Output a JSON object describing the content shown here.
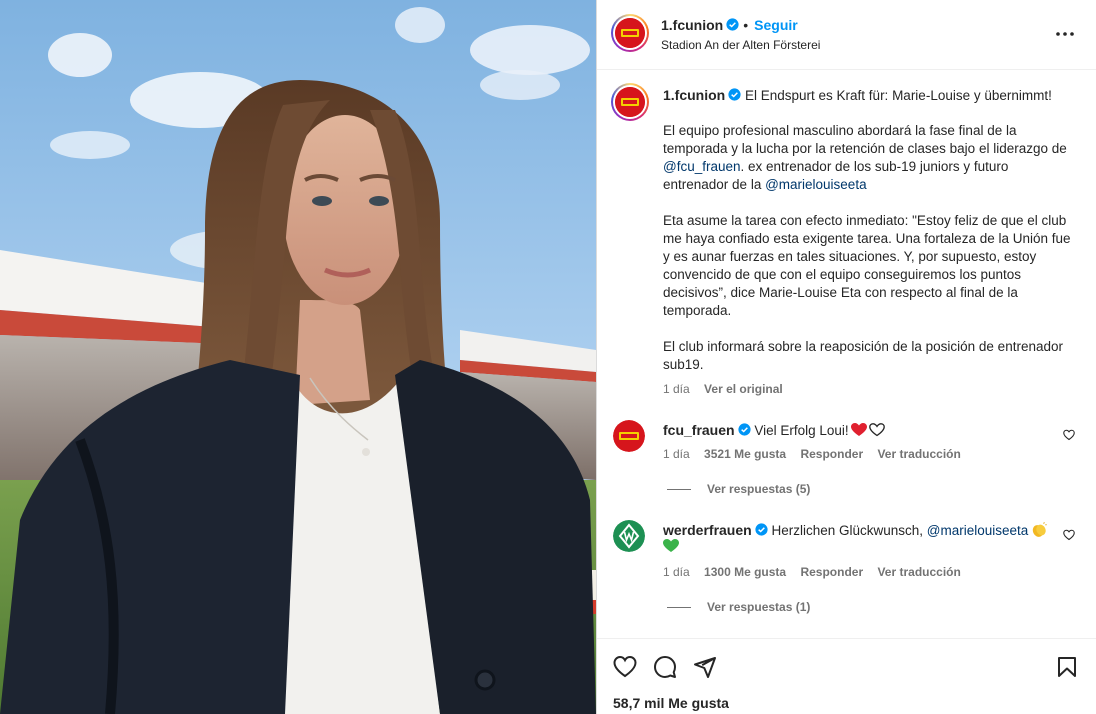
{
  "post": {
    "account": {
      "username": "1.fcunion",
      "follow_label": "Seguir",
      "separator": "•",
      "location": "Stadion An der Alten Försterei",
      "verified": true,
      "avatar_color": "#d6151c"
    },
    "caption": {
      "username": "1.fcunion",
      "headline": "El Endspurt es Kraft für: Marie-Louise y übernimmt!",
      "p1_part1": "El equipo profesional masculino abordará la fase final de la temporada y la lucha por la retención de clases bajo el liderazgo de ",
      "p1_mention1": "@fcu_frauen",
      "p1_part2": ". ex entrenador de los sub-19 juniors y futuro entrenador de la ",
      "p1_mention2": "@marielouiseeta",
      "p2": "Eta asume la tarea con efecto inmediato: \"Estoy feliz de que el club me haya confiado esta exigente tarea. Una fortaleza de la Unión fue y es aunar fuerzas en tales situaciones. Y, por supuesto, estoy convencido de que con el equipo conseguiremos los puntos decisivos”, dice Marie-Louise Eta con respecto al final de la temporada.",
      "p3": "El club informará sobre la reaposición de la posición de entrenador sub19.",
      "time": "1 día",
      "see_original": "Ver el original"
    },
    "comments": [
      {
        "username": "fcu_frauen",
        "text": "Viel Erfolg Loui!",
        "time": "1 día",
        "likes": "3521 Me gusta",
        "reply": "Responder",
        "translate": "Ver traducción",
        "view_replies": "Ver respuestas (5)"
      },
      {
        "username": "werderfrauen",
        "text": "Herzlichen Glückwunsch, ",
        "mention": "@marielouiseeta",
        "time": "1 día",
        "likes": "1300 Me gusta",
        "reply": "Responder",
        "translate": "Ver traducción",
        "view_replies": "Ver respuestas (1)",
        "avatar_color": "#1d9053"
      }
    ],
    "likes_count": "58,7 mil Me gusta",
    "colors": {
      "link_blue": "#0095f6",
      "mention": "#00376b",
      "secondary_text": "#737373",
      "verified": "#0095f6"
    },
    "icons": [
      "more-icon",
      "verified-icon",
      "heart-icon",
      "comment-icon",
      "share-icon",
      "bookmark-icon"
    ]
  }
}
